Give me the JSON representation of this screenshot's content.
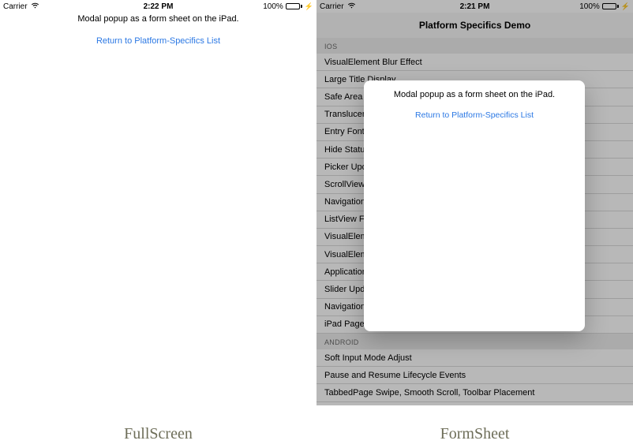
{
  "statusBar": {
    "carrier": "Carrier",
    "batteryPct": "100%"
  },
  "left": {
    "time": "2:22 PM",
    "modalText": "Modal popup as a form sheet on the iPad.",
    "returnLink": "Return to Platform-Specifics List",
    "caption": "FullScreen"
  },
  "right": {
    "time": "2:21 PM",
    "navTitle": "Platform Specifics Demo",
    "sections": {
      "ios": {
        "header": "IOS",
        "items": [
          "VisualElement Blur Effect",
          "Large Title Display",
          "Safe Area Layout Guide",
          "Translucent Navigation Bar",
          "Entry FontSize",
          "Hide Status Bar",
          "Picker UpdateMode",
          "ScrollView DelayContentTouches",
          "NavigationPage Translucent",
          "ListView FullWidth Separators",
          "VisualElement Legacy Color Mode",
          "VisualElement Drop Shadow",
          "Application PanGesture",
          "Slider UpdateOnTap",
          "NavigationPage Large Titles",
          "iPad Page Modal"
        ]
      },
      "android": {
        "header": "ANDROID",
        "items": [
          "Soft Input Mode Adjust",
          "Pause and Resume Lifecycle Events",
          "TabbedPage Swipe, Smooth Scroll, Toolbar Placement"
        ]
      }
    },
    "modalText": "Modal popup as a form sheet on the iPad.",
    "returnLink": "Return to Platform-Specifics List",
    "caption": "FormSheet"
  }
}
